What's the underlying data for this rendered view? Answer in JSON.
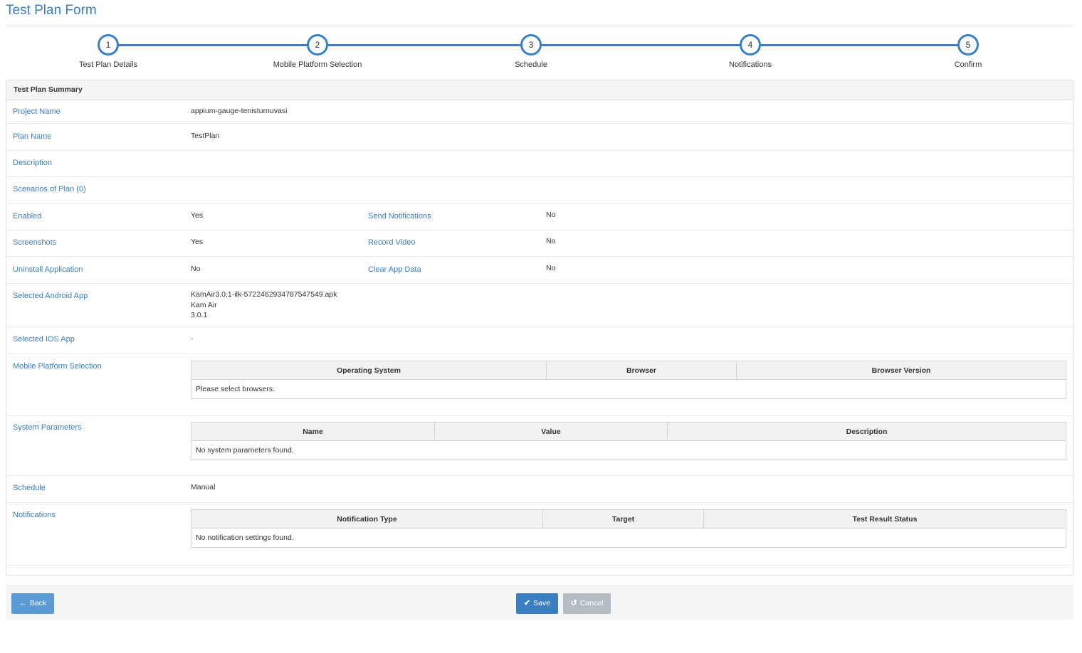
{
  "page": {
    "title": "Test Plan Form"
  },
  "wizard": {
    "steps": [
      {
        "number": "1",
        "label": "Test Plan Details"
      },
      {
        "number": "2",
        "label": "Mobile Platform Selection"
      },
      {
        "number": "3",
        "label": "Schedule"
      },
      {
        "number": "4",
        "label": "Notifications"
      },
      {
        "number": "5",
        "label": "Confirm"
      }
    ]
  },
  "summary": {
    "heading": "Test Plan Summary",
    "project_name": {
      "label": "Project Name",
      "value": "appium-gauge-tenisturnuvasi"
    },
    "plan_name": {
      "label": "Plan Name",
      "value": "TestPlan"
    },
    "description": {
      "label": "Description",
      "value": ""
    },
    "scenarios": {
      "label": "Scenarios of Plan (0)"
    },
    "enabled": {
      "label": "Enabled",
      "value": "Yes"
    },
    "send_notifications": {
      "label": "Send Notifications",
      "value": "No"
    },
    "screenshots": {
      "label": "Screenshots",
      "value": "Yes"
    },
    "record_video": {
      "label": "Record Video",
      "value": "No"
    },
    "uninstall_application": {
      "label": "Uninstall Application",
      "value": "No"
    },
    "clear_app_data": {
      "label": "Clear App Data",
      "value": "No"
    },
    "android_app": {
      "label": "Selected Android App",
      "file": "KamAir3.0.1-ilk-5722462934787547549.apk",
      "name": "Kam Air",
      "version": "3.0.1"
    },
    "ios_app": {
      "label": "Selected IOS App",
      "value": "-"
    },
    "mobile_platform": {
      "label": "Mobile Platform Selection",
      "columns": [
        "Operating System",
        "Browser",
        "Browser Version"
      ],
      "empty_text": "Please select browsers."
    },
    "system_parameters": {
      "label": "System Parameters",
      "columns": [
        "Name",
        "Value",
        "Description"
      ],
      "empty_text": "No system parameters found."
    },
    "schedule": {
      "label": "Schedule",
      "value": "Manual"
    },
    "notifications": {
      "label": "Notifications",
      "columns": [
        "Notification Type",
        "Target",
        "Test Result Status"
      ],
      "empty_text": "No notification settings found."
    }
  },
  "footer": {
    "back_label": "Back",
    "save_label": "Save",
    "cancel_label": "Cancel"
  },
  "colors": {
    "accent": "#3a7fc1",
    "back_button": "#5b9bd5",
    "cancel_button": "#b6bcc3"
  },
  "icons": {
    "back": "arrow-left-icon",
    "save": "check-icon",
    "cancel": "undo-icon"
  }
}
